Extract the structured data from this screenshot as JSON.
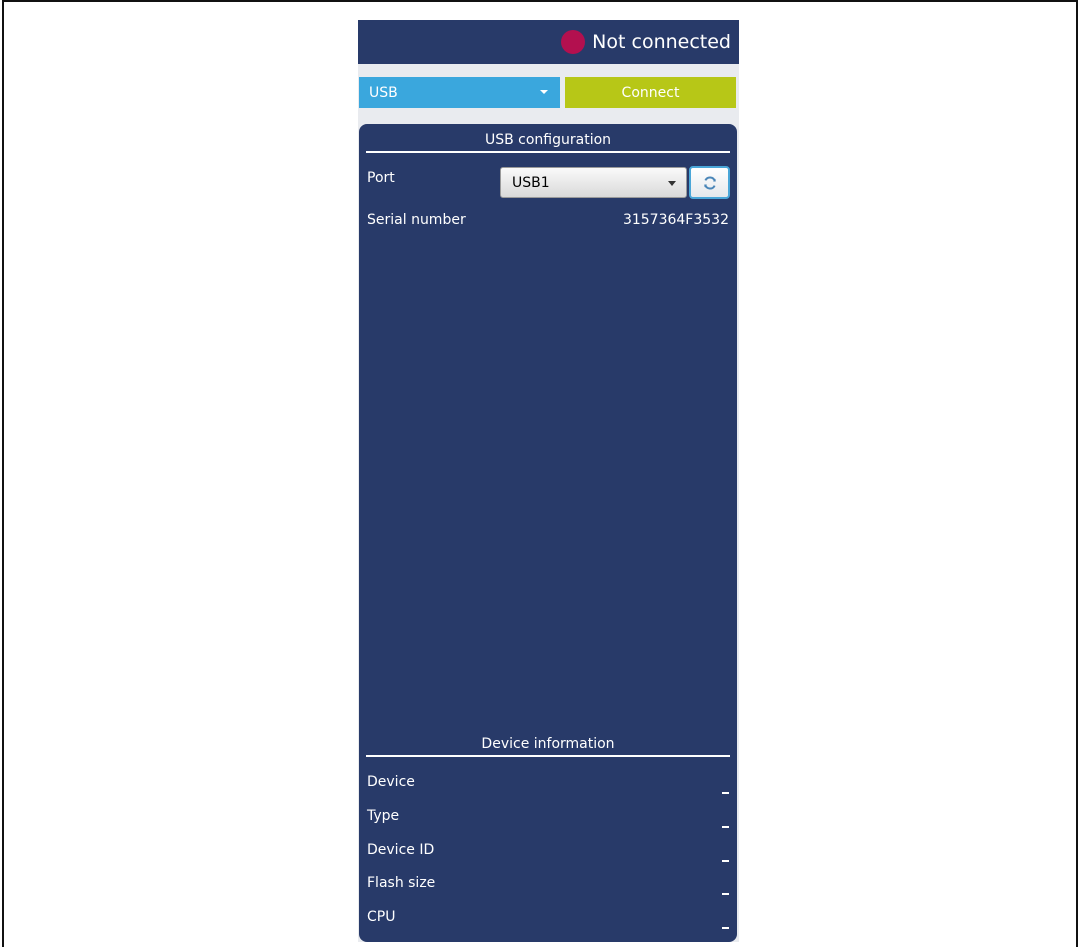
{
  "status": {
    "text": "Not connected",
    "indicator_color": "#b3104f"
  },
  "connection": {
    "type_selected": "USB",
    "connect_label": "Connect"
  },
  "usb_config": {
    "title": "USB configuration",
    "port_label": "Port",
    "port_value": "USB1",
    "refresh_icon": "refresh-icon",
    "serial_label": "Serial number",
    "serial_value": "3157364F3532"
  },
  "device_info": {
    "title": "Device information",
    "rows": [
      {
        "label": "Device",
        "value": "_"
      },
      {
        "label": "Type",
        "value": "_"
      },
      {
        "label": "Device ID",
        "value": "_"
      },
      {
        "label": "Flash size",
        "value": "_"
      },
      {
        "label": "CPU",
        "value": "_"
      }
    ]
  },
  "colors": {
    "panel_bg": "#283a69",
    "connection_select": "#3aa7dd",
    "connect_button": "#b7c717"
  }
}
